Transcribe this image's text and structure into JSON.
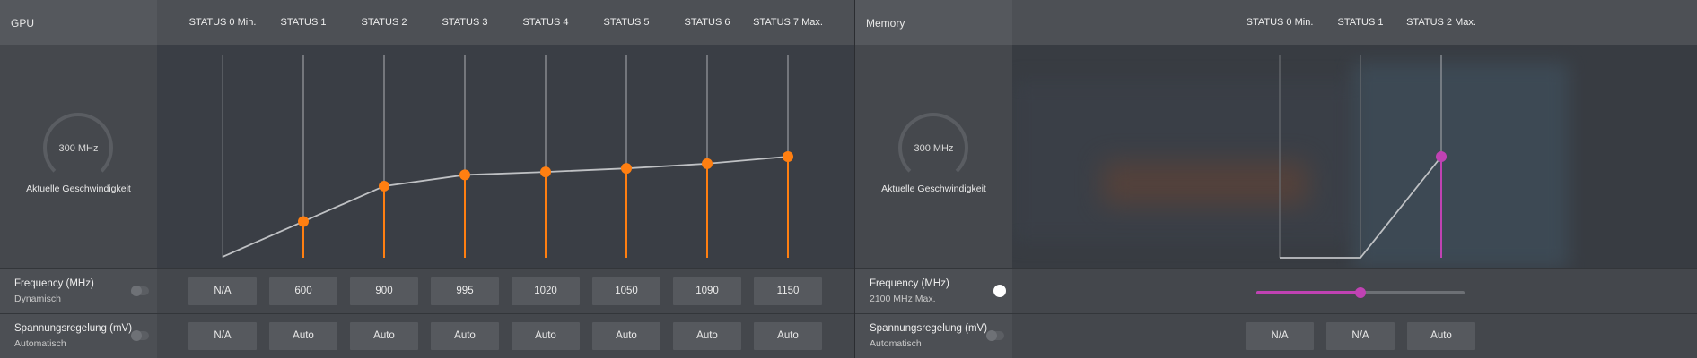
{
  "gpu": {
    "title": "GPU",
    "speed": {
      "value": "300 MHz",
      "label": "Aktuelle Geschwindigkeit"
    },
    "states": [
      "STATUS 0 Min.",
      "STATUS 1",
      "STATUS 2",
      "STATUS 3",
      "STATUS 4",
      "STATUS 5",
      "STATUS 6",
      "STATUS 7 Max."
    ],
    "frequency": {
      "label": "Frequency (MHz)",
      "mode": "Dynamisch",
      "toggle_on": false,
      "values": [
        "N/A",
        "600",
        "900",
        "995",
        "1020",
        "1050",
        "1090",
        "1150"
      ]
    },
    "voltage": {
      "label": "Spannungsregelung (mV)",
      "mode": "Automatisch",
      "toggle_on": false,
      "values": [
        "N/A",
        "Auto",
        "Auto",
        "Auto",
        "Auto",
        "Auto",
        "Auto",
        "Auto"
      ]
    },
    "accent": "#ff7f11"
  },
  "memory": {
    "title": "Memory",
    "speed": {
      "value": "300 MHz",
      "label": "Aktuelle Geschwindigkeit"
    },
    "states": [
      "STATUS 0 Min.",
      "STATUS 1",
      "STATUS 2 Max."
    ],
    "frequency": {
      "label": "Frequency (MHz)",
      "mode": "2100 MHz Max.",
      "toggle_on": true,
      "slider_fraction": 0.5
    },
    "voltage": {
      "label": "Spannungsregelung (mV)",
      "mode": "Automatisch",
      "toggle_on": false,
      "values": [
        "N/A",
        "N/A",
        "Auto"
      ]
    },
    "accent": "#c042b3"
  }
}
